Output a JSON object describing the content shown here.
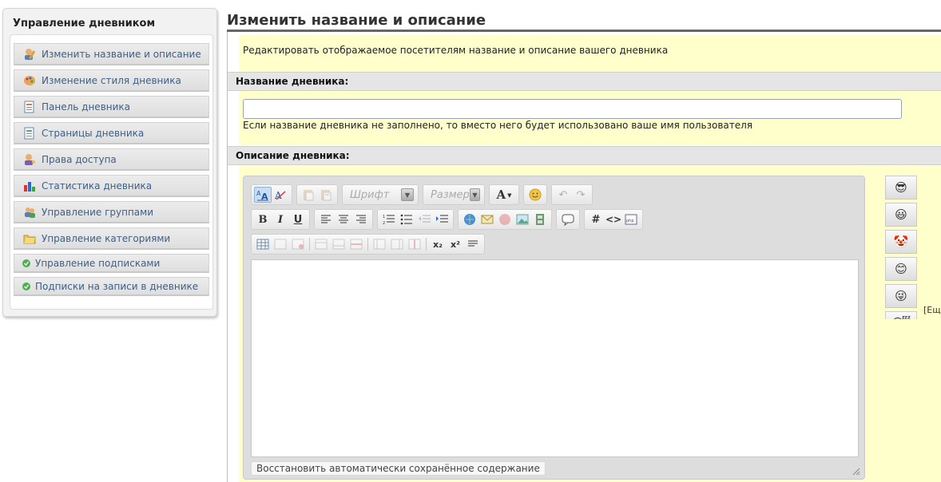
{
  "sidebar": {
    "title": "Управление дневником",
    "items": [
      {
        "label": "Изменить название и описание",
        "icon": "user-edit-icon"
      },
      {
        "label": "Изменение стиля дневника",
        "icon": "palette-icon"
      },
      {
        "label": "Панель дневника",
        "icon": "panel-icon"
      },
      {
        "label": "Страницы дневника",
        "icon": "pages-icon"
      },
      {
        "label": "Права доступа",
        "icon": "user-key-icon"
      },
      {
        "label": "Статистика дневника",
        "icon": "bar-chart-icon"
      },
      {
        "label": "Управление группами",
        "icon": "users-icon"
      },
      {
        "label": "Управление категориями",
        "icon": "folders-icon"
      },
      {
        "label": "Управление подписками",
        "icon": "check-dot-icon"
      },
      {
        "label": "Подписки на записи в дневнике",
        "icon": "check-dot-icon"
      }
    ]
  },
  "main": {
    "title": "Изменить название и описание",
    "intro": "Редактировать отображаемое посетителям название и описание вашего дневника",
    "name_section": {
      "label": "Название дневника:",
      "value": "",
      "hint": "Если название дневника не заполнено, то вместо него будет использовано ваше имя пользователя"
    },
    "description_section": {
      "label": "Описание дневника:"
    }
  },
  "editor": {
    "font_combo": "Шрифт",
    "size_combo": "Размер",
    "text_color_label": "A",
    "bold": "B",
    "italic": "I",
    "underline": "U",
    "hash": "#",
    "code": "<>",
    "subscript": "x₂",
    "superscript": "x²",
    "restore_label": "Восстановить автоматически сохранённое содержание"
  },
  "smileys": {
    "more_label": "[Ещё]",
    "items": [
      "😎",
      "😃",
      "🤡",
      "😊",
      "😜",
      "😴"
    ]
  }
}
